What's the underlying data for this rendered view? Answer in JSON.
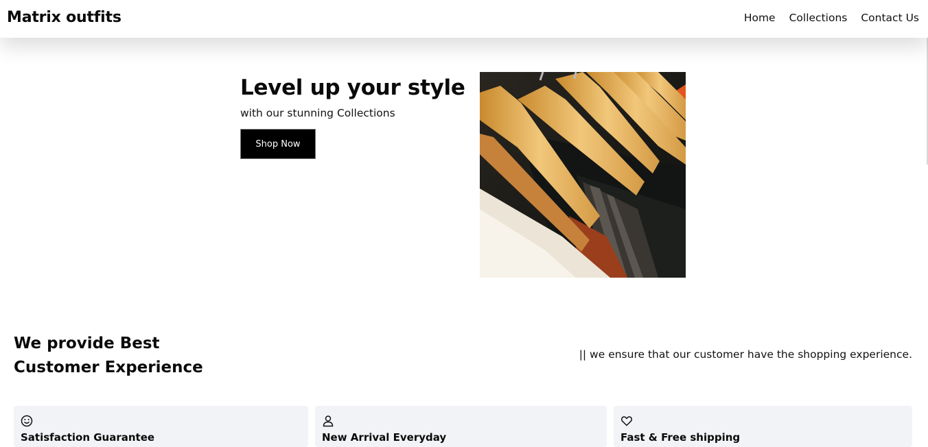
{
  "navbar": {
    "brand": "Matrix outfits",
    "links": [
      "Home",
      "Collections",
      "Contact Us"
    ]
  },
  "hero": {
    "title": "Level up your style",
    "subtitle": "with our stunning Collections",
    "button_label": "Shop Now"
  },
  "experience": {
    "title_line1": "We provide Best",
    "title_line2": "Customer Experience",
    "description": "|| we ensure that our customer have the shopping experience."
  },
  "features": [
    {
      "icon": "smile-icon",
      "title": "Satisfaction Guarantee"
    },
    {
      "icon": "user-icon",
      "title": "New Arrival Everyday"
    },
    {
      "icon": "heart-icon",
      "title": "Fast & Free shipping"
    }
  ],
  "colors": {
    "button_bg": "#000000",
    "card_bg": "#f2f3f6"
  }
}
